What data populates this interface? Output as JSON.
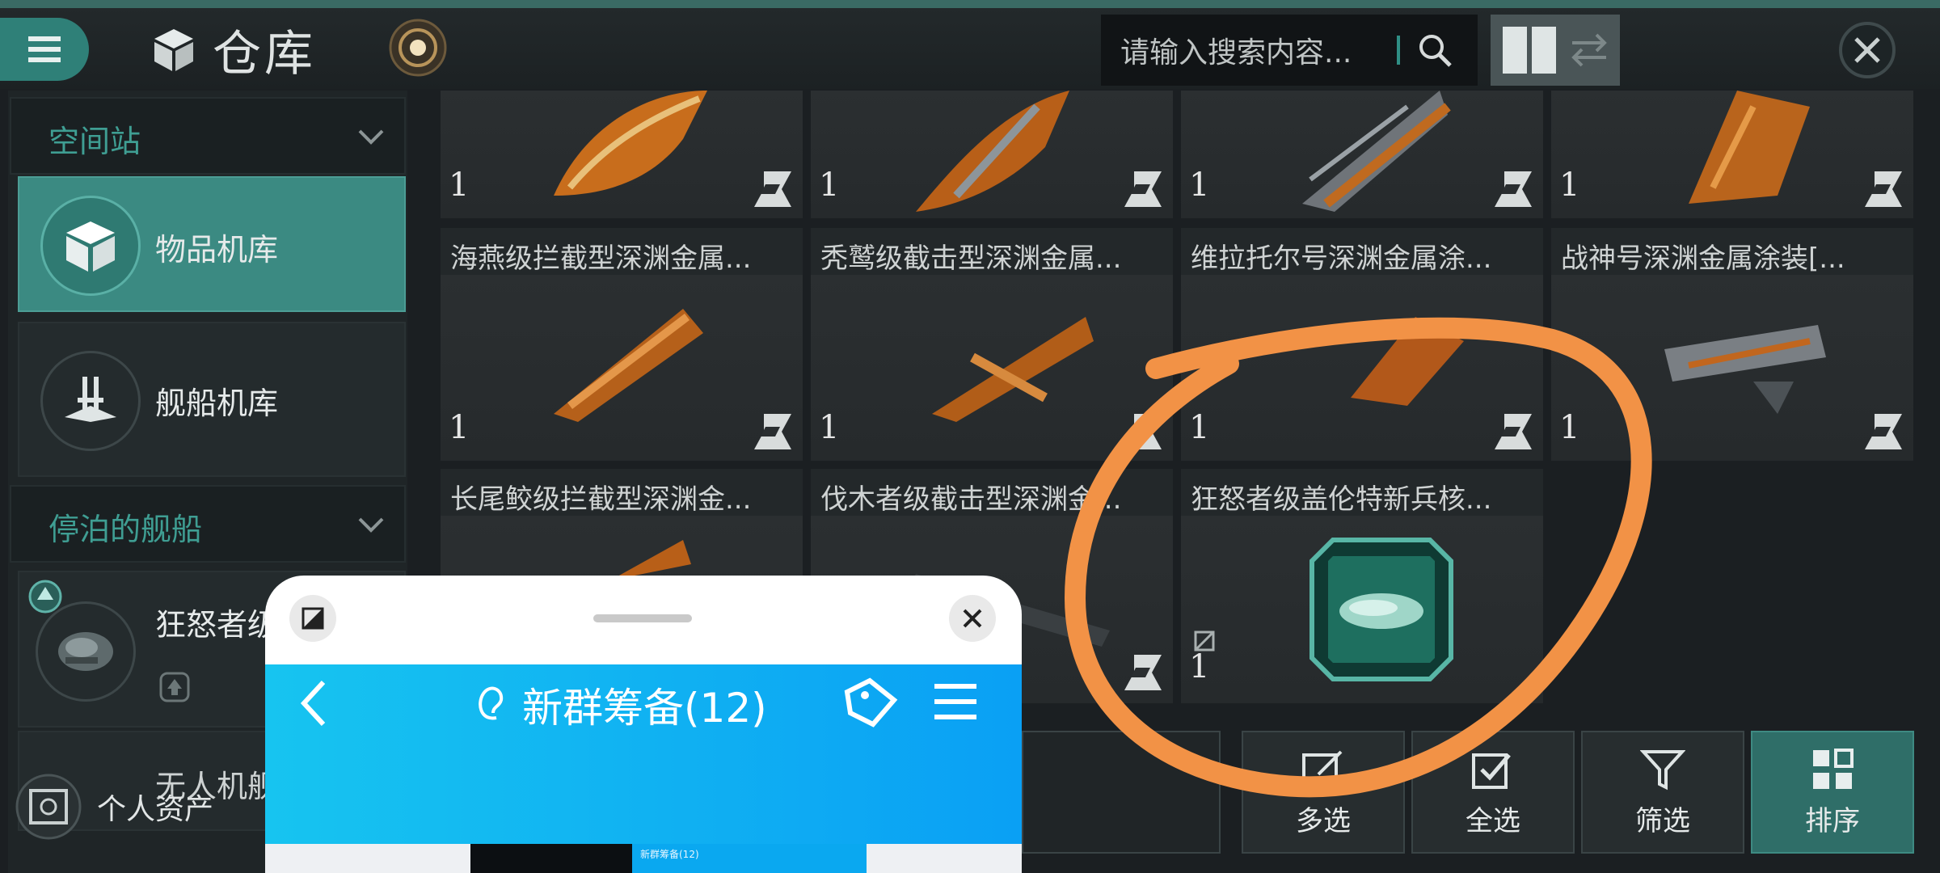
{
  "header": {
    "title": "仓库",
    "search_placeholder": "请输入搜索内容...",
    "icons": [
      "menu-icon",
      "cube-icon",
      "beacon-icon",
      "search-icon",
      "grid-view-icon",
      "swap-icon",
      "close-icon"
    ]
  },
  "sidebar": {
    "section_station": "空间站",
    "item_items_hangar": "物品机库",
    "item_ship_hangar": "舰船机库",
    "section_docked": "停泊的舰船",
    "docked_ship_label": "狂怒者级",
    "partial_item": "无人机舰",
    "personal_assets": "个人资产"
  },
  "grid": {
    "items": [
      {
        "name": "",
        "count": "1"
      },
      {
        "name": "",
        "count": "1"
      },
      {
        "name": "",
        "count": "1"
      },
      {
        "name": "",
        "count": "1"
      },
      {
        "name": "海燕级拦截型深渊金属...",
        "count": "1"
      },
      {
        "name": "秃鹫级截击型深渊金属...",
        "count": "1"
      },
      {
        "name": "维拉托尔号深渊金属涂...",
        "count": "1"
      },
      {
        "name": "战神号深渊金属涂装[...",
        "count": "1"
      },
      {
        "name": "长尾鲛级拦截型深渊金...",
        "count": ""
      },
      {
        "name": "伐木者级截击型深渊金...",
        "count": ""
      },
      {
        "name": "狂怒者级盖伦特新兵核...",
        "count": "1"
      }
    ]
  },
  "bottom_buttons": {
    "multi_select": "多选",
    "select_all": "全选",
    "filter": "筛选",
    "sort": "排序"
  },
  "chat_window": {
    "title": "新群筹备(12)",
    "thumbnail_title": "新群筹备(12)"
  },
  "colors": {
    "accent": "#3b8a82",
    "annotation": "#f29246",
    "chat_header": "#0fb3f2"
  }
}
